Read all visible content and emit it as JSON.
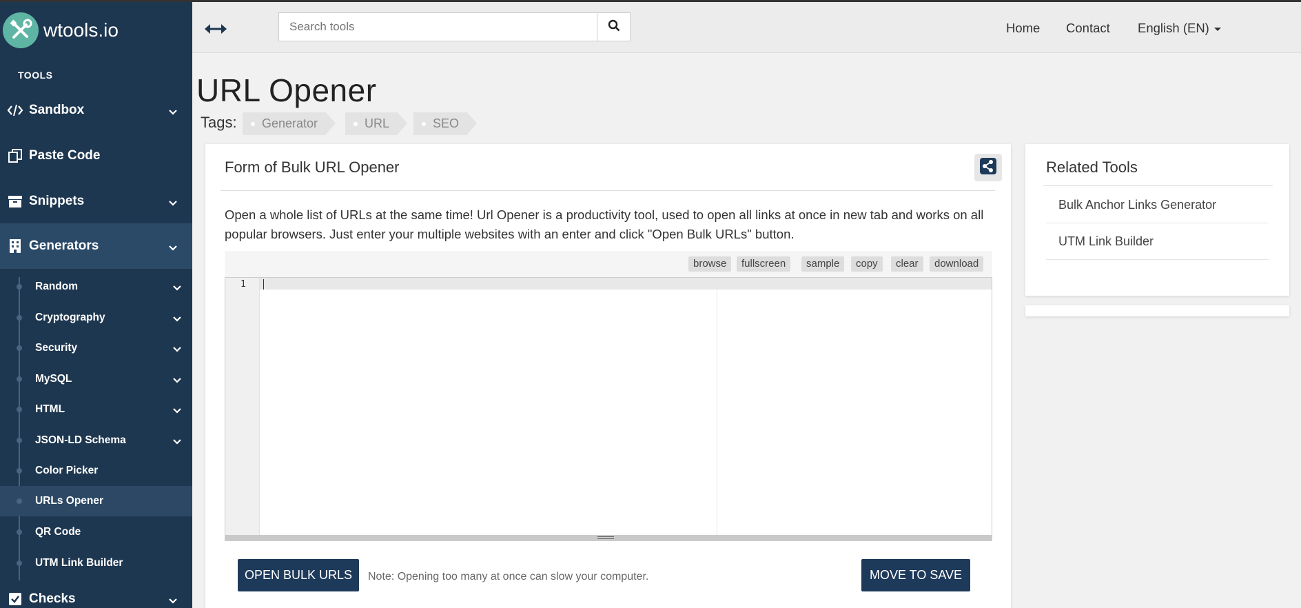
{
  "app": {
    "logo_text": "wtools.io"
  },
  "sidebar": {
    "section_header": "TOOLS",
    "groups": [
      {
        "label": "Sandbox",
        "icon": "code-icon",
        "has_chevron": true
      },
      {
        "label": "Paste Code",
        "icon": "copy-icon",
        "has_chevron": false
      },
      {
        "label": "Snippets",
        "icon": "archive-icon",
        "has_chevron": true
      },
      {
        "label": "Generators",
        "icon": "building-icon",
        "has_chevron": true,
        "expanded": true
      },
      {
        "label": "Checks",
        "icon": "checkbox-icon",
        "has_chevron": true
      }
    ],
    "generator_items": [
      {
        "label": "Random",
        "has_chevron": true
      },
      {
        "label": "Cryptography",
        "has_chevron": true
      },
      {
        "label": "Security",
        "has_chevron": true
      },
      {
        "label": "MySQL",
        "has_chevron": true
      },
      {
        "label": "HTML",
        "has_chevron": true
      },
      {
        "label": "JSON-LD Schema",
        "has_chevron": true
      },
      {
        "label": "Color Picker",
        "has_chevron": false
      },
      {
        "label": "URLs Opener",
        "has_chevron": false,
        "active": true
      },
      {
        "label": "QR Code",
        "has_chevron": false
      },
      {
        "label": "UTM Link Builder",
        "has_chevron": false
      }
    ]
  },
  "topbar": {
    "search_placeholder": "Search tools",
    "nav": {
      "home": "Home",
      "contact": "Contact",
      "language": "English (EN)"
    }
  },
  "page": {
    "title": "URL Opener",
    "tags_label": "Tags:",
    "tags": [
      "Generator",
      "URL",
      "SEO"
    ]
  },
  "form": {
    "title": "Form of Bulk URL Opener",
    "description": "Open a whole list of URLs at the same time! Url Opener is a productivity tool, used to open all links at once in new tab and works on all popular browsers. Just enter your multiple websites with an enter and click \"Open Bulk URLs\" button.",
    "editor_buttons": [
      "browse",
      "fullscreen",
      "sample",
      "copy",
      "clear",
      "download"
    ],
    "line_number": "1",
    "open_button": "OPEN BULK URLS",
    "note": "Note: Opening too many at once can slow your computer.",
    "save_button": "MOVE TO SAVE"
  },
  "related": {
    "title": "Related Tools",
    "items": [
      "Bulk Anchor Links Generator",
      "UTM Link Builder"
    ]
  },
  "colors": {
    "sidebar_bg": "#1e3750",
    "button_dark": "#1e3a5a",
    "logo_accent": "#5fb5a4",
    "page_bg": "#f1f1f1"
  }
}
